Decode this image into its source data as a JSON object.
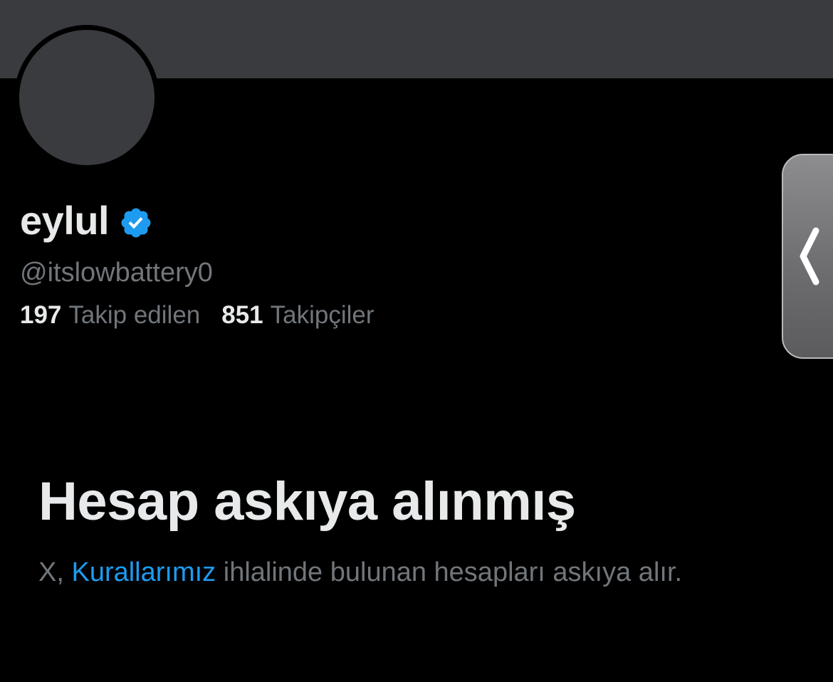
{
  "profile": {
    "display_name": "eylul",
    "verified_icon": "verified-badge-icon",
    "handle": "@itslowbattery0",
    "following_count": "197",
    "following_label": "Takip edilen",
    "followers_count": "851",
    "followers_label": "Takipçiler"
  },
  "suspension": {
    "title": "Hesap askıya alınmış",
    "desc_prefix": "X, ",
    "rules_link": "Kurallarımız",
    "desc_suffix": " ihlalinde bulunan hesapları askıya alır."
  },
  "colors": {
    "background": "#000000",
    "banner": "#3a3b3f",
    "text_primary": "#e7e9ea",
    "text_secondary": "#71767b",
    "link": "#1d9bf0",
    "verified": "#1d9bf0"
  },
  "icons": {
    "side_handle": "chevron-left-icon"
  }
}
